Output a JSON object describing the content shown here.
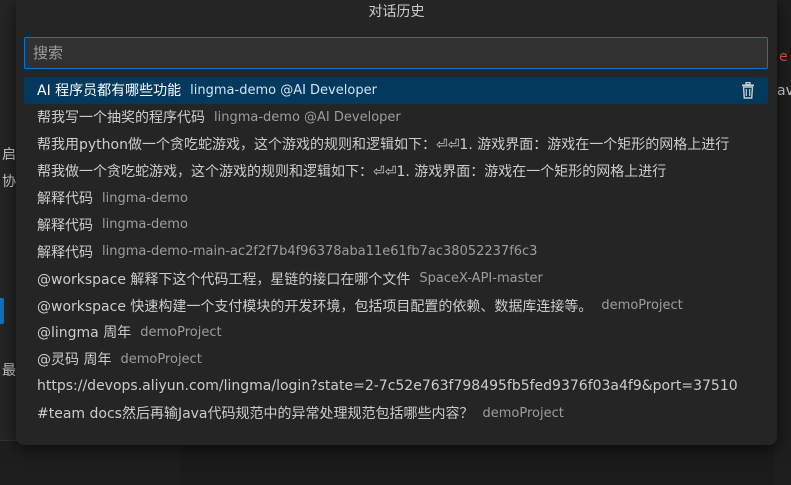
{
  "background": {
    "fragments": [
      "e",
      "ava",
      "启",
      "协",
      "最"
    ]
  },
  "panel": {
    "title": "对话历史",
    "search": {
      "placeholder": "搜索",
      "value": ""
    },
    "items": [
      {
        "label": "AI 程序员都有哪些功能",
        "desc": "lingma-demo @AI Developer",
        "selected": true
      },
      {
        "label": "帮我写一个抽奖的程序代码",
        "desc": "lingma-demo @AI Developer"
      },
      {
        "label": "帮我用python做一个贪吃蛇游戏，这个游戏的规则和逻辑如下：⏎⏎1. 游戏界面：游戏在一个矩形的网格上进行",
        "desc": ""
      },
      {
        "label": "帮我做一个贪吃蛇游戏，这个游戏的规则和逻辑如下：⏎⏎1. 游戏界面：游戏在一个矩形的网格上进行",
        "desc": ""
      },
      {
        "label": "解释代码",
        "desc": "lingma-demo"
      },
      {
        "label": "解释代码",
        "desc": "lingma-demo"
      },
      {
        "label": "解释代码",
        "desc": "lingma-demo-main-ac2f2f7b4f96378aba11e61fb7ac38052237f6c3"
      },
      {
        "label": "@workspace  解释下这个代码工程，星链的接口在哪个文件",
        "desc": "SpaceX-API-master"
      },
      {
        "label": "@workspace 快速构建一个支付模块的开发环境，包括项目配置的依赖、数据库连接等。",
        "desc": "demoProject"
      },
      {
        "label": "@lingma 周年",
        "desc": "demoProject"
      },
      {
        "label": "@灵码 周年",
        "desc": "demoProject"
      },
      {
        "label": "https://devops.aliyun.com/lingma/login?state=2-7c52e763f798495fb5fed9376f03a4f9&port=37510",
        "desc": ""
      },
      {
        "label": "#team docs然后再输Java代码规范中的异常处理规范包括哪些内容？",
        "desc": "demoProject"
      }
    ],
    "delete_icon": "trash-icon"
  }
}
